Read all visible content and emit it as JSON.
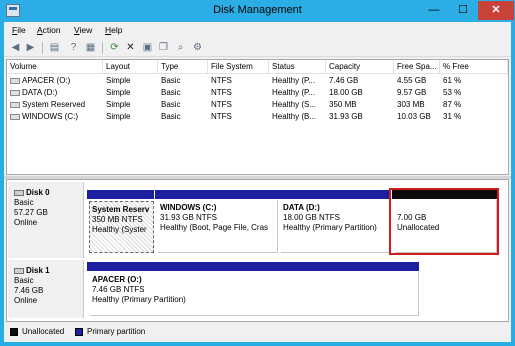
{
  "window": {
    "title": "Disk Management",
    "min_glyph": "—",
    "max_glyph": "☐",
    "close_glyph": "✕"
  },
  "menu": [
    "File",
    "Action",
    "View",
    "Help"
  ],
  "toolbar": [
    "back-icon",
    "forward-icon",
    "list-icon",
    "help-icon",
    "properties-icon",
    "refresh-icon",
    "delete-icon",
    "new-volume-icon",
    "copy-icon",
    "search-icon",
    "settings-icon"
  ],
  "volume_columns": [
    "Volume",
    "Layout",
    "Type",
    "File System",
    "Status",
    "Capacity",
    "Free Spa...",
    "% Free"
  ],
  "volumes": [
    {
      "volume": "APACER (O:)",
      "layout": "Simple",
      "type": "Basic",
      "fs": "NTFS",
      "status": "Healthy (P...",
      "capacity": "7.46 GB",
      "free": "4.55 GB",
      "pct": "61 %"
    },
    {
      "volume": "DATA (D:)",
      "layout": "Simple",
      "type": "Basic",
      "fs": "NTFS",
      "status": "Healthy (P...",
      "capacity": "18.00 GB",
      "free": "9.57 GB",
      "pct": "53 %"
    },
    {
      "volume": "System Reserved",
      "layout": "Simple",
      "type": "Basic",
      "fs": "NTFS",
      "status": "Healthy (S...",
      "capacity": "350 MB",
      "free": "303 MB",
      "pct": "87 %"
    },
    {
      "volume": "WINDOWS (C:)",
      "layout": "Simple",
      "type": "Basic",
      "fs": "NTFS",
      "status": "Healthy (B...",
      "capacity": "31.93 GB",
      "free": "10.03 GB",
      "pct": "31 %"
    }
  ],
  "disks": [
    {
      "name": "Disk 0",
      "kind": "Basic",
      "size": "57.27 GB",
      "state": "Online",
      "partitions": [
        {
          "name": "System Reserv",
          "size": "350 MB NTFS",
          "status": "Healthy (Syster"
        },
        {
          "name": "WINDOWS (C:)",
          "size": "31.93 GB NTFS",
          "status": "Healthy (Boot, Page File, Cras"
        },
        {
          "name": "DATA (D:)",
          "size": "18.00 GB NTFS",
          "status": "Healthy (Primary Partition)"
        },
        {
          "name": "",
          "size": "7.00 GB",
          "status": "Unallocated"
        }
      ]
    },
    {
      "name": "Disk 1",
      "kind": "Basic",
      "size": "7.46 GB",
      "state": "Online",
      "partitions": [
        {
          "name": "APACER (O:)",
          "size": "7.46 GB NTFS",
          "status": "Healthy (Primary Partition)"
        }
      ]
    }
  ],
  "legend": [
    {
      "label": "Unallocated",
      "color": "#0c0c0c"
    },
    {
      "label": "Primary partition",
      "color": "#1d1fa1"
    }
  ]
}
